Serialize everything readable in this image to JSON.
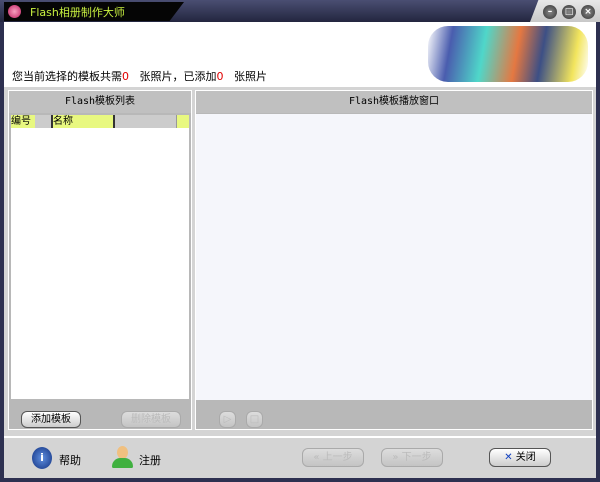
{
  "window": {
    "title": "Flash相册制作大师"
  },
  "header": {
    "info_prefix": "您当前选择的模板共需",
    "required_count": "0",
    "info_mid": "张照片，已添加",
    "added_count": "0",
    "info_suffix": "张照片"
  },
  "left_panel": {
    "title": "Flash模板列表",
    "columns": [
      "编号",
      "名称"
    ],
    "add_button": "添加模板",
    "delete_button": "删除模板"
  },
  "right_panel": {
    "title": "Flash模板播放窗口"
  },
  "footer": {
    "help": "帮助",
    "register": "注册",
    "prev": "上一步",
    "next": "下一步",
    "close": "关闭"
  }
}
